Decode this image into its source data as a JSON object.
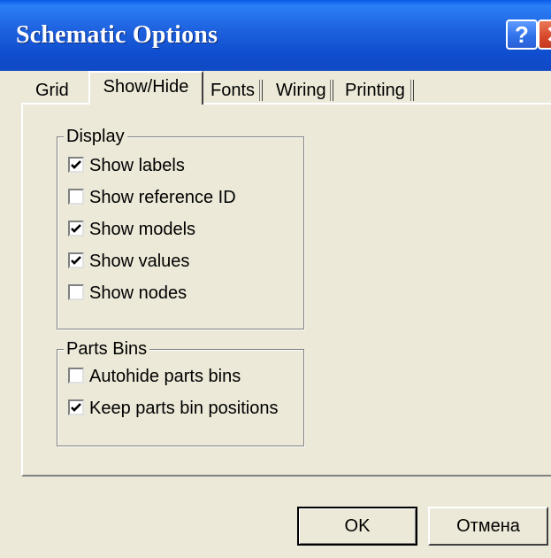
{
  "window": {
    "title": "Schematic Options",
    "help_glyph": "?",
    "close_glyph": "✕"
  },
  "tabs": [
    {
      "label": "Grid",
      "active": false
    },
    {
      "label": "Show/Hide",
      "active": true
    },
    {
      "label": "Fonts",
      "active": false
    },
    {
      "label": "Wiring",
      "active": false
    },
    {
      "label": "Printing",
      "active": false
    }
  ],
  "display_group": {
    "title": "Display",
    "items": [
      {
        "label": "Show labels",
        "checked": true
      },
      {
        "label": "Show reference ID",
        "checked": false
      },
      {
        "label": "Show models",
        "checked": true
      },
      {
        "label": "Show values",
        "checked": true
      },
      {
        "label": "Show nodes",
        "checked": false
      }
    ]
  },
  "parts_bins_group": {
    "title": "Parts Bins",
    "items": [
      {
        "label": "Autohide parts bins",
        "checked": false
      },
      {
        "label": "Keep parts bin positions",
        "checked": true
      }
    ]
  },
  "buttons": {
    "ok": "OK",
    "cancel": "Отмена"
  },
  "colors": {
    "titlebar": "#1f63e0",
    "dialog_bg": "#ece9d8",
    "close_button": "#d8472a"
  }
}
